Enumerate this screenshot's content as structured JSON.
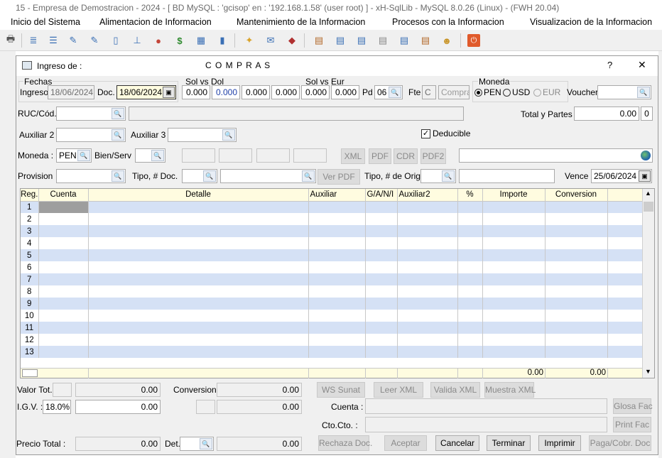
{
  "window": {
    "title": "15 - Empresa de Demostracion - 2024 - [ BD MySQL : 'gcisop' en : '192.168.1.58' (user root) ] - xH-SqlLib - MySQL 8.0.26 (Linux) - (FWH 20.04)"
  },
  "menu": [
    "Inicio del Sistema",
    "Alimentacion de Informacion",
    "Mantenimiento de la Informacion",
    "Procesos con la Informacion",
    "Visualizacion de la Informacion"
  ],
  "dialog": {
    "title": "Ingreso de :",
    "heading": "C O M P R A S",
    "help": "?",
    "close": "✕"
  },
  "fechas": {
    "group": "Fechas",
    "ingreso_label": "Ingreso",
    "ingreso": "18/06/2024",
    "doc_label": "Doc.",
    "doc": "18/06/2024"
  },
  "sol_vs_dol": {
    "group": "Sol vs Dol",
    "v1": "0.000",
    "v2": "0.000"
  },
  "mid": {
    "v1": "0.000",
    "v2": "0.000"
  },
  "sol_vs_eur": {
    "group": "Sol vs Eur",
    "v1": "0.000",
    "v2": "0.000"
  },
  "pd": {
    "label": "Pd",
    "value": "06"
  },
  "fte": {
    "label": "Fte",
    "value": "C",
    "type": "Compra"
  },
  "moneda": {
    "group": "Moneda",
    "options": [
      "PEN",
      "USD",
      "EUR"
    ],
    "selected": "PEN"
  },
  "voucher": {
    "label": "Voucher",
    "value": ""
  },
  "ruc": {
    "label": "RUC/Cód.",
    "value": "",
    "desc": ""
  },
  "total_partes": {
    "label": "Total y Partes",
    "value": "0.00",
    "parts": "0"
  },
  "auxiliar2": {
    "label": "Auxiliar 2",
    "value": ""
  },
  "auxiliar3": {
    "label": "Auxiliar 3",
    "value": ""
  },
  "deducible": {
    "label": "Deducible",
    "checked": true
  },
  "moneda_row": {
    "label": "Moneda :",
    "value": "PEN",
    "bien_label": "Bien/Serv"
  },
  "doc_buttons": [
    "XML",
    "PDF",
    "CDR",
    "PDF2"
  ],
  "provision": {
    "label": "Provision",
    "tipo_doc_label": "Tipo, # Doc.",
    "ver_pdf": "Ver PDF",
    "tipo_orig_label": "Tipo, # de Orig.",
    "vence_label": "Vence",
    "vence": "25/06/2024"
  },
  "grid": {
    "columns": [
      "Reg.",
      "Cuenta",
      "Detalle",
      "Auxiliar",
      "G/A/N/I",
      "Auxiliar2",
      "%",
      "Importe",
      "Conversion"
    ],
    "rows": [
      "1",
      "2",
      "3",
      "4",
      "5",
      "6",
      "7",
      "8",
      "9",
      "10",
      "11",
      "12",
      "13"
    ],
    "footer_importe": "0.00",
    "footer_conversion": "0.00"
  },
  "totals": {
    "valor_label": "Valor Tot.",
    "valor": "0.00",
    "conversion_label": "Conversion",
    "conversion": "0.00",
    "igv_label": "I.G.V. :",
    "igv_pct": "18.0%",
    "igv": "0.00",
    "igv_conv": "0.00",
    "precio_label": "Precio Total :",
    "precio": "0.00",
    "det_label": "Det.",
    "det_value": "0.00"
  },
  "xml_buttons": [
    "WS Sunat",
    "Leer XML",
    "Valida XML",
    "Muestra XML"
  ],
  "cuenta_label": "Cuenta :",
  "ccto_label": "Cto.Cto. :",
  "side_buttons": [
    "Glosa Fac",
    "Print Fac"
  ],
  "action_buttons": [
    "Rechaza Doc.",
    "Aceptar",
    "Cancelar",
    "Terminar",
    "Imprimir",
    "Paga/Cobr. Doc"
  ]
}
